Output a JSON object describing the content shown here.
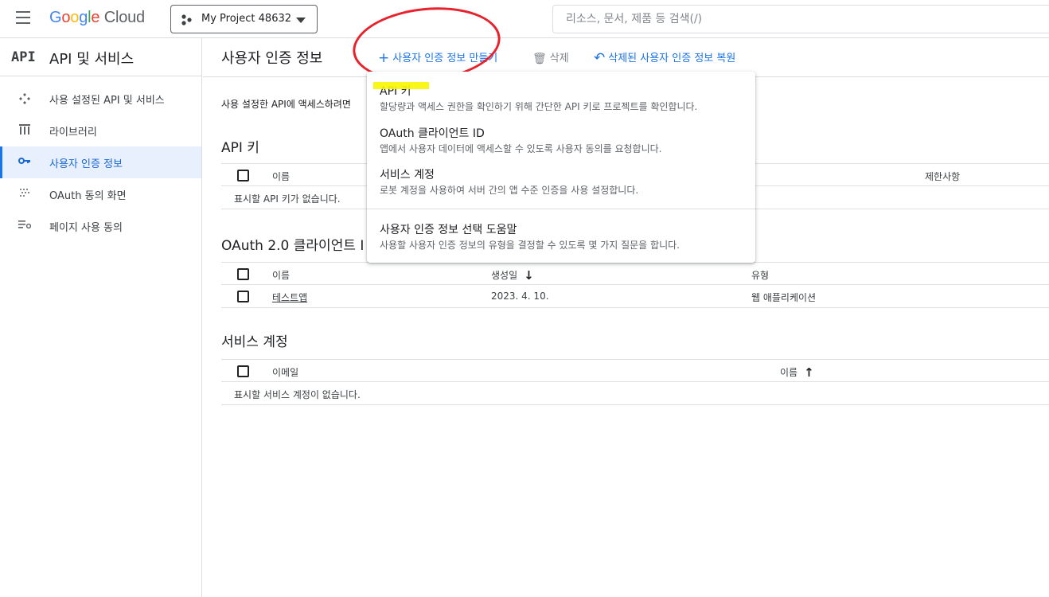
{
  "topbar": {
    "logo_letters": [
      "G",
      "o",
      "o",
      "g",
      "l",
      "e"
    ],
    "logo_cloud": "Cloud",
    "project_name": "My Project 48632",
    "search_placeholder": "리소스, 문서, 제품 등 검색(/)"
  },
  "sidebar": {
    "api_icon_text": "API",
    "title": "API 및 서비스",
    "items": [
      {
        "label": "사용 설정된 API 및 서비스",
        "icon": "apis-icon"
      },
      {
        "label": "라이브러리",
        "icon": "library-icon"
      },
      {
        "label": "사용자 인증 정보",
        "icon": "key-icon",
        "active": true
      },
      {
        "label": "OAuth 동의 화면",
        "icon": "oauth-icon"
      },
      {
        "label": "페이지 사용 동의",
        "icon": "settings-list-icon"
      }
    ]
  },
  "toolbar": {
    "page_title": "사용자 인증 정보",
    "create_label": "사용자 인증 정보 만들기",
    "delete_label": "삭제",
    "restore_label": "삭제된 사용자 인증 정보 복원"
  },
  "main": {
    "description": "사용 설정한 API에 액세스하려면",
    "api_keys": {
      "title": "API 키",
      "col_name": "이름",
      "col_restrictions": "제한사항",
      "empty": "표시할 API 키가 없습니다."
    },
    "oauth": {
      "title": "OAuth 2.0 클라이언트 I",
      "col_name": "이름",
      "col_created": "생성일",
      "col_type": "유형",
      "rows": [
        {
          "name": "테스트앱",
          "created": "2023. 4. 10.",
          "type": "웹 애플리케이션"
        }
      ]
    },
    "service_accounts": {
      "title": "서비스 계정",
      "col_email": "이메일",
      "col_name": "이름",
      "empty": "표시할 서비스 계정이 없습니다."
    }
  },
  "menu": {
    "items": [
      {
        "title": "API 키",
        "desc": "할당량과 액세스 권한을 확인하기 위해 간단한 API 키로 프로젝트를 확인합니다."
      },
      {
        "title": "OAuth 클라이언트 ID",
        "desc": "앱에서 사용자 데이터에 액세스할 수 있도록 사용자 동의를 요청합니다."
      },
      {
        "title": "서비스 계정",
        "desc": "로봇 계정을 사용하여 서버 간의 앱 수준 인증을 사용 설정합니다."
      },
      {
        "title": "사용자 인증 정보 선택 도움말",
        "desc": "사용할 사용자 인증 정보의 유형을 결정할 수 있도록 몇 가지 질문을 합니다."
      }
    ]
  },
  "colors": {
    "accent": "#1a73e8",
    "annotation_red": "#e8222d",
    "annotation_yellow": "#f7f600"
  }
}
